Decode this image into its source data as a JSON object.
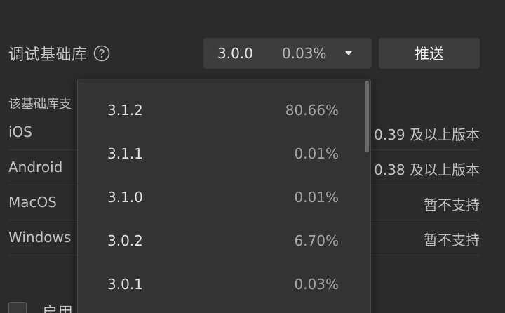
{
  "section": {
    "title": "调试基础库",
    "help_icon": "question-circle-icon",
    "push_label": "推送",
    "selected_version": "3.0.0",
    "selected_percent": "0.03%",
    "support_desc": "该基础库支"
  },
  "platforms": [
    {
      "name": "iOS",
      "status": "0.39 及以上版本"
    },
    {
      "name": "Android",
      "status": "0.38 及以上版本"
    },
    {
      "name": "MacOS",
      "status": "暂不支持"
    },
    {
      "name": "Windows",
      "status": "暂不支持"
    }
  ],
  "enable": {
    "label": "启用"
  },
  "dropdown": {
    "options": [
      {
        "version": "3.1.2",
        "percent": "80.66%"
      },
      {
        "version": "3.1.1",
        "percent": "0.01%"
      },
      {
        "version": "3.1.0",
        "percent": "0.01%"
      },
      {
        "version": "3.0.2",
        "percent": "6.70%"
      },
      {
        "version": "3.0.1",
        "percent": "0.03%"
      }
    ]
  },
  "colors": {
    "background": "#2b2b2b",
    "control": "#3d3d3d",
    "dropdown": "#333333"
  }
}
